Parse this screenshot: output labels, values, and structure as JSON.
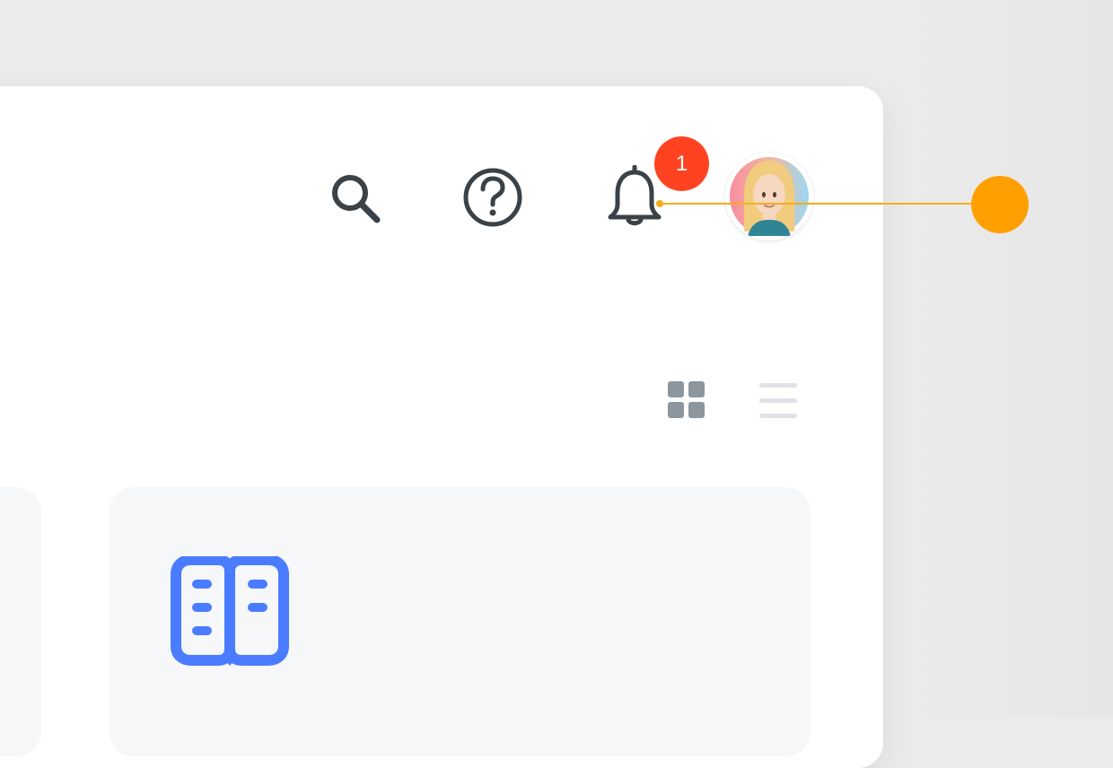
{
  "header": {
    "icons": {
      "search": "search-icon",
      "help": "help-icon",
      "notifications": "bell-icon"
    },
    "notification_count": "1",
    "avatar": "avatar-image"
  },
  "views": {
    "grid": "grid-icon",
    "list": "list-icon"
  },
  "cards": {
    "main_icon": "book-icon"
  },
  "colors": {
    "background": "#ebebeb",
    "panel": "#ffffff",
    "card": "#f5f7f9",
    "icon_dark": "#3a4147",
    "badge": "#ff4321",
    "book_icon": "#4a7cff",
    "callout": "#ffa000"
  }
}
